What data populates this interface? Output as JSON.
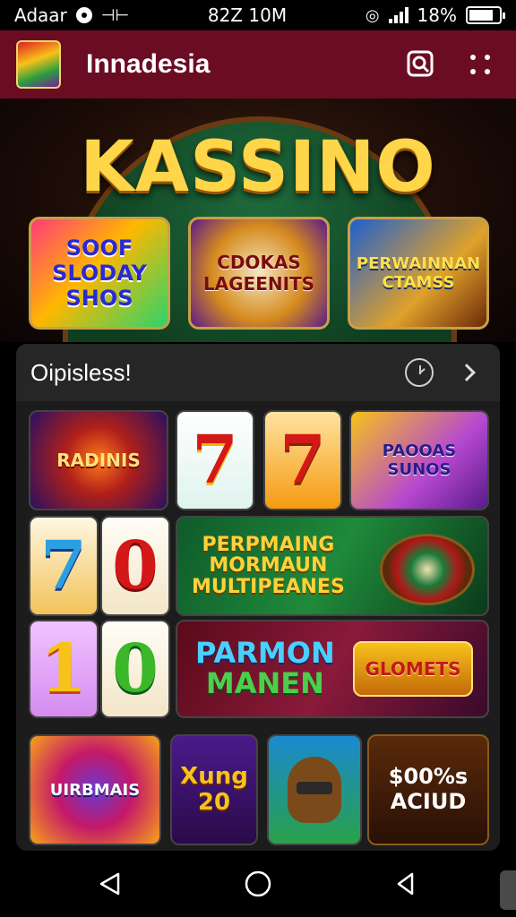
{
  "status_bar": {
    "carrier": "Adaar",
    "time": "82Z 10M",
    "battery": "18%",
    "battery_level": 0.8
  },
  "app_bar": {
    "title": "Innadesia",
    "search_icon": "search-icon",
    "menu_icon": "more-vert-icon"
  },
  "hero": {
    "title": "KASSINO",
    "cards": [
      "SOOF SLODAY SHOS",
      "CDOKAS LAGEENITS",
      "PERWAINNAN CTAMSS"
    ]
  },
  "section": {
    "title": "Oipisless!",
    "history_icon": "clock-icon",
    "next_icon": "chevron-right-icon"
  },
  "games": {
    "radiants": "RADINIS",
    "seven_a": "7",
    "seven_b": "7",
    "pagoas": "PAOOAS SUNOS",
    "seven_c": "7",
    "zero_a": "0",
    "perm_line1": "PERPMAING",
    "perm_line2": "MORMAUN",
    "perm_line3": "MULTIPEANES",
    "one": "1",
    "zero_b": "0",
    "parmon_line1": "PARMON",
    "parmon_line2": "MANEN",
    "glomets": "GLOMETS",
    "uirb": "UIRBMAIS",
    "xung_line1": "Xung",
    "xung_line2": "20",
    "acud_line1": "$00%s",
    "acud_line2": "ACIUD"
  },
  "nav": {
    "back_icon": "back-triangle-icon",
    "home_icon": "home-circle-icon",
    "recents_icon": "recents-triangle-icon"
  }
}
